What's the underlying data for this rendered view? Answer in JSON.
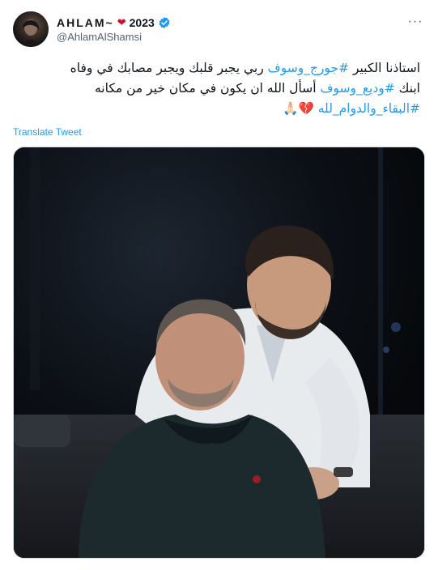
{
  "author": {
    "display_name": "AHLAM~",
    "name_suffix": "2023",
    "handle": "@AhlamAlShamsi",
    "heart_icon": "red-heart-icon",
    "verified_icon": "verified-badge-icon"
  },
  "menu_icon": "more-options-icon",
  "tweet": {
    "line1": {
      "before": "استاذنا الكبير ",
      "hashtag": "#جورج_وسوف",
      "after": "   ربي يجبر قلبك ويجبر مصابك في وفاه"
    },
    "line2": {
      "before": "ابنك ",
      "hashtag": "#وديع_وسوف",
      "after": "  أسأل الله ان يكون في مكان خير من مكانه"
    },
    "line3": {
      "hashtag": "#البقاء_والدوام_لله",
      "emoji": " 💔🙏🏻"
    }
  },
  "translate_label": "Translate Tweet",
  "colors": {
    "link": "#1d9bf0",
    "text": "#0f1419",
    "muted": "#536471",
    "heart": "#c8102e"
  }
}
